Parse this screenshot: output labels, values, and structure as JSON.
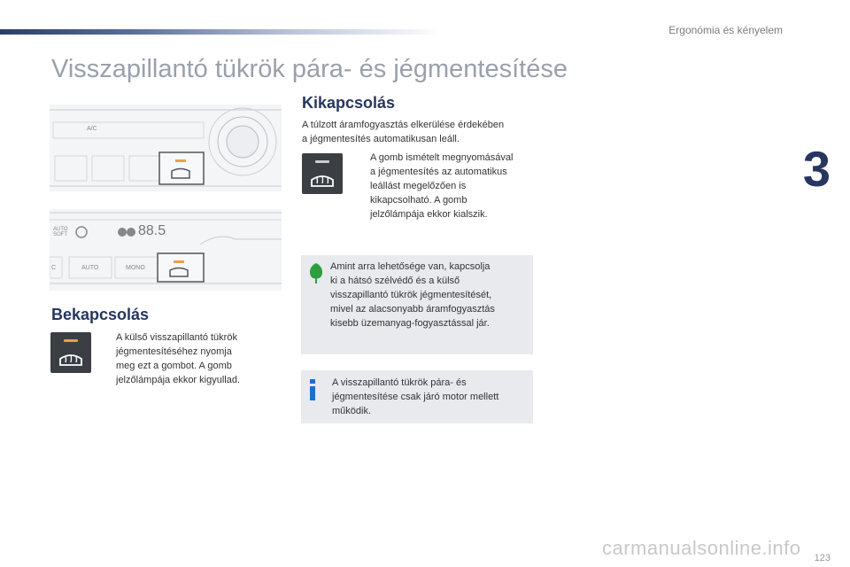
{
  "header": {
    "section_label": "Ergonómia és kényelem",
    "chapter_number": "3"
  },
  "page_title": "Visszapillantó tükrök pára- és jégmentesítése",
  "off_section": {
    "heading": "Kikapcsolás",
    "intro": [
      "A túlzott áramfogyasztás elkerülése érdekében",
      "a jégmentesítés automatikusan leáll."
    ],
    "bullet_lines": [
      "A gomb ismételt megnyomásával",
      "a jégmentesítés az automatikus",
      "leállást megelőzően is",
      "kikapcsolható. A gomb",
      "jelzőlámpája ekkor kialszik."
    ]
  },
  "on_section": {
    "heading": "Bekapcsolás",
    "bullet_lines": [
      "A külső visszapillantó tükrök",
      "jégmentesítéséhez nyomja",
      "meg ezt a gombot. A gomb",
      "jelzőlámpája ekkor kigyullad."
    ]
  },
  "eco_note": {
    "lines": [
      "Amint arra lehetősége van, kapcsolja",
      "ki a hátsó szélvédő és a külső",
      "visszapillantó tükrök jégmentesítését,",
      "mivel az alacsonyabb áramfogyasztás",
      "kisebb üzemanyag-fogyasztással jár."
    ],
    "icon": "leaf-icon",
    "accent": "#2e9e3e"
  },
  "info_note": {
    "lines": [
      "A visszapillantó tükrök pára- és",
      "jégmentesítése csak járó motor mellett",
      "működik."
    ],
    "icon": "info-icon",
    "accent": "#1c6fd1"
  },
  "panel1": {
    "ac_label": "A/C"
  },
  "panel2": {
    "display": "88.5",
    "auto_label": "AUTO",
    "mono_label": "MONO",
    "auto_soft": "AUTO SOFT",
    "c_label": "C"
  },
  "bullet_symbol": "",
  "footer": {
    "page_number": "123",
    "watermark": "carmanualsonline.info"
  },
  "colors": {
    "heading": "#26365e",
    "title": "#9aa0ab",
    "led_on": "#e9a14a"
  }
}
